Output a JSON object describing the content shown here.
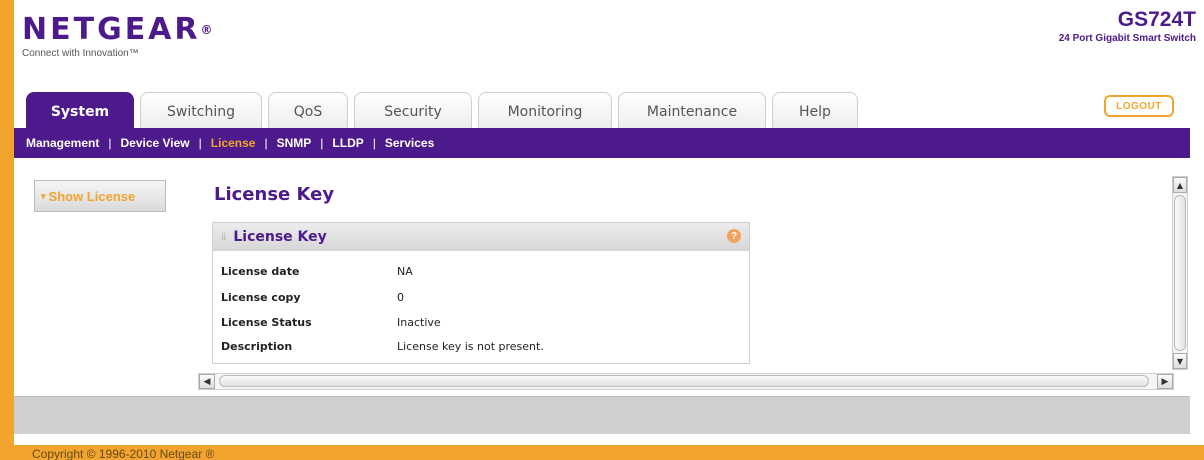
{
  "header": {
    "brand": "NETGEAR",
    "brand_mark": "®",
    "tagline": "Connect with Innovation™",
    "model_name": "GS724T",
    "model_desc": "24 Port Gigabit Smart Switch",
    "logout_label": "LOGOUT"
  },
  "tabs": [
    {
      "label": "System",
      "active": true
    },
    {
      "label": "Switching",
      "active": false
    },
    {
      "label": "QoS",
      "active": false
    },
    {
      "label": "Security",
      "active": false
    },
    {
      "label": "Monitoring",
      "active": false
    },
    {
      "label": "Maintenance",
      "active": false
    },
    {
      "label": "Help",
      "active": false
    }
  ],
  "subnav": [
    {
      "label": "Management",
      "active": false
    },
    {
      "label": "Device View",
      "active": false
    },
    {
      "label": "License",
      "active": true
    },
    {
      "label": "SNMP",
      "active": false
    },
    {
      "label": "LLDP",
      "active": false
    },
    {
      "label": "Services",
      "active": false
    }
  ],
  "sidebar": {
    "show_license_label": "Show License"
  },
  "main": {
    "page_title": "License Key",
    "panel_title": "License Key",
    "rows": [
      {
        "label": "License date",
        "value": "NA"
      },
      {
        "label": "License copy",
        "value": "0"
      },
      {
        "label": "License Status",
        "value": "Inactive"
      },
      {
        "label": "Description",
        "value": "License key is not present."
      }
    ]
  },
  "footer": {
    "copyright": "Copyright © 1996-2010 Netgear ®"
  },
  "colors": {
    "brand_purple": "#4d1a8b",
    "accent_orange": "#f1a52e"
  },
  "icons": {
    "help": "help-icon",
    "chevron": "chevron-down-icon",
    "scroll_up": "arrow-up-icon",
    "scroll_down": "arrow-down-icon",
    "scroll_left": "arrow-left-icon",
    "scroll_right": "arrow-right-icon"
  }
}
